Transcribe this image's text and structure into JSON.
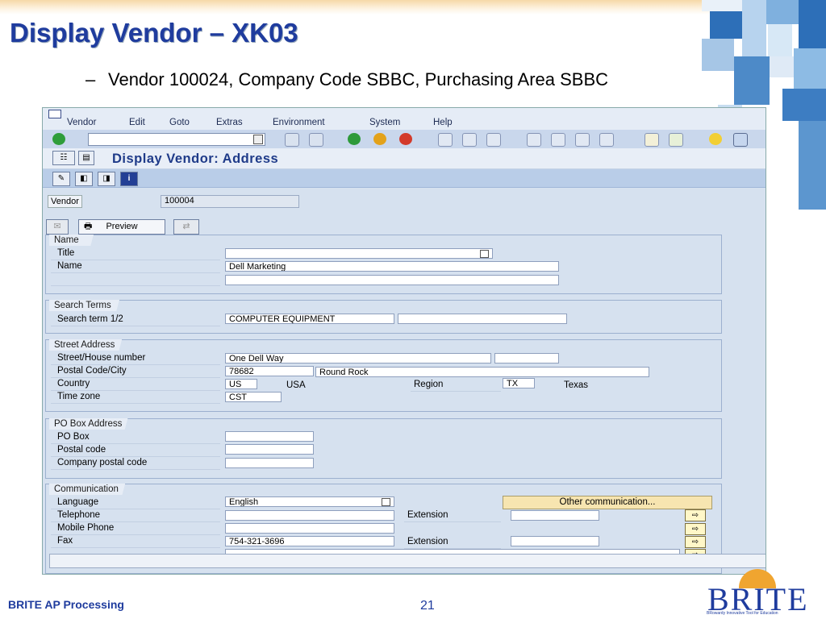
{
  "slide": {
    "title": "Display Vendor – XK03",
    "bullet": "Vendor 100024, Company Code SBBC, Purchasing Area SBBC",
    "footer": "BRITE AP Processing",
    "page_number": "21",
    "logo_text": "BRITE",
    "logo_tagline": "BRowardy Innovative Tool for Education"
  },
  "sap": {
    "menu": [
      "Vendor",
      "Edit",
      "Goto",
      "Extras",
      "Environment",
      "System",
      "Help"
    ],
    "screen_title": "Display Vendor: Address",
    "preview_label": "Preview",
    "vendor_label": "Vendor",
    "vendor_value": "100004",
    "groups": {
      "name": {
        "title": "Name",
        "title_label": "Title",
        "name_label": "Name",
        "name_value": "Dell Marketing"
      },
      "search": {
        "title": "Search Terms",
        "label": "Search term 1/2",
        "value": "COMPUTER EQUIPMENT"
      },
      "street": {
        "title": "Street Address",
        "street_label": "Street/House number",
        "street_value": "One Dell Way",
        "postal_label": "Postal Code/City",
        "postal_value": "78682",
        "city_value": "Round Rock",
        "country_label": "Country",
        "country_code": "US",
        "country_name": "USA",
        "region_label": "Region",
        "region_code": "TX",
        "region_name": "Texas",
        "timezone_label": "Time zone",
        "timezone_value": "CST"
      },
      "pobox": {
        "title": "PO Box Address",
        "pobox_label": "PO Box",
        "postal_label": "Postal code",
        "company_postal_label": "Company postal code"
      },
      "comm": {
        "title": "Communication",
        "language_label": "Language",
        "language_value": "English",
        "other_button": "Other communication...",
        "telephone_label": "Telephone",
        "extension_label": "Extension",
        "mobile_label": "Mobile Phone",
        "fax_label": "Fax",
        "fax_value": "754-321-3696",
        "fax_extension_label": "Extension"
      }
    }
  }
}
